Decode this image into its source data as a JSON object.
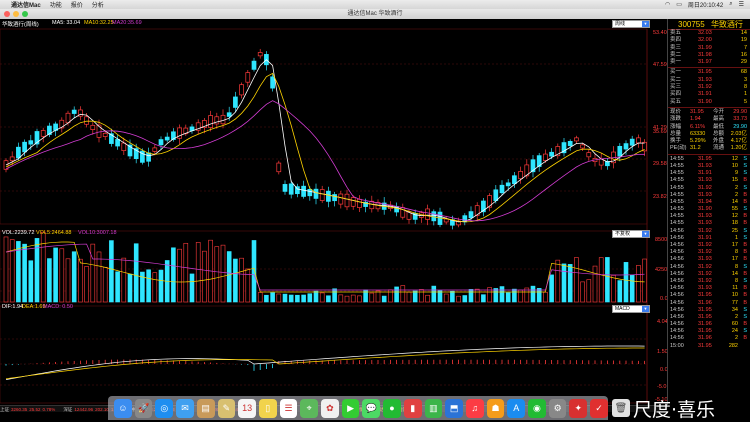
{
  "menubar": {
    "apple": "",
    "app": "通达信Mac",
    "items": [
      "功能",
      "报价",
      "分析"
    ],
    "clock": "周日20:10:42"
  },
  "window": {
    "title": "通达信Mac 华致酒行"
  },
  "chart": {
    "title": "华致酒行(周线)",
    "ma_legend": [
      {
        "t": "MA5: 33.04",
        "c": "#ffffff"
      },
      {
        "t": "MA10:32.25",
        "c": "#ffd400"
      },
      {
        "t": "MA20:35.69",
        "c": "#d23cd2"
      }
    ],
    "vol_legend": [
      {
        "t": "VOL:2239.72",
        "c": "#ffffff"
      },
      {
        "t": "VOL5:2464.88",
        "c": "#ffd400"
      },
      {
        "t": "VOL10:3007.18",
        "c": "#d23cd2"
      }
    ],
    "macd_legend": [
      {
        "t": "DIF:1.94",
        "c": "#ffffff"
      },
      {
        "t": "DEA:1.69",
        "c": "#ffd400"
      },
      {
        "t": "MACD: 0.50",
        "c": "#d23cd2"
      }
    ],
    "period_select": "周线",
    "vol_select": "不复权",
    "macd_select": "MACD",
    "price_axis": [
      "53.40",
      "47.59",
      "41.29",
      "35.69",
      "29.58",
      "23.82"
    ],
    "vol_axis": [
      "8500",
      "4250",
      "0.0"
    ],
    "macd_axis": [
      "4.04",
      "1.50",
      "0.0",
      "-5.0",
      "-5.10"
    ],
    "colors": {
      "up": "#ff3b3b",
      "down": "#2fe6ff",
      "grid": "#5a1010"
    }
  },
  "right_panel": {
    "code": "300755",
    "name": "华致酒行",
    "order_book": [
      {
        "l": "卖五",
        "p": "32.03",
        "v": "14"
      },
      {
        "l": "卖四",
        "p": "32.00",
        "v": "19"
      },
      {
        "l": "卖三",
        "p": "31.99",
        "v": "7"
      },
      {
        "l": "卖二",
        "p": "31.98",
        "v": "16"
      },
      {
        "l": "卖一",
        "p": "31.97",
        "v": "29"
      },
      {
        "l": "买一",
        "p": "31.95",
        "v": "68"
      },
      {
        "l": "买二",
        "p": "31.93",
        "v": "3"
      },
      {
        "l": "买三",
        "p": "31.92",
        "v": "8"
      },
      {
        "l": "买四",
        "p": "31.91",
        "v": "1"
      },
      {
        "l": "买五",
        "p": "31.90",
        "v": "5"
      }
    ],
    "stats": [
      {
        "a": "现价",
        "b": "31.95",
        "c": "今开",
        "d": "29.90"
      },
      {
        "a": "涨跌",
        "b": "1.94",
        "c": "最高",
        "d": "33.73"
      },
      {
        "a": "涨幅",
        "b": "6.11%",
        "c": "最低",
        "d": "29.90"
      },
      {
        "a": "总量",
        "b": "63330",
        "c": "总额",
        "d": "2.03亿"
      },
      {
        "a": "换手",
        "b": "5.29%",
        "c": "外盘",
        "d": "4.17亿"
      },
      {
        "a": "PE(动)",
        "b": "31.2",
        "c": "流通",
        "d": "1.20亿"
      }
    ],
    "ticks": [
      {
        "t": "14:55",
        "p": "31.95",
        "v": "12",
        "s": "S"
      },
      {
        "t": "14:55",
        "p": "31.93",
        "v": "10",
        "s": "S"
      },
      {
        "t": "14:55",
        "p": "31.91",
        "v": "9",
        "s": "S"
      },
      {
        "t": "14:55",
        "p": "31.93",
        "v": "15",
        "s": "B"
      },
      {
        "t": "14:55",
        "p": "31.92",
        "v": "2",
        "s": "S"
      },
      {
        "t": "14:55",
        "p": "31.93",
        "v": "2",
        "s": "B"
      },
      {
        "t": "14:55",
        "p": "31.94",
        "v": "14",
        "s": "B"
      },
      {
        "t": "14:55",
        "p": "31.90",
        "v": "55",
        "s": "S"
      },
      {
        "t": "14:55",
        "p": "31.93",
        "v": "12",
        "s": "B"
      },
      {
        "t": "14:55",
        "p": "31.93",
        "v": "18",
        "s": "B"
      },
      {
        "t": "14:56",
        "p": "31.92",
        "v": "25",
        "s": "S"
      },
      {
        "t": "14:56",
        "p": "31.91",
        "v": "1",
        "s": "S"
      },
      {
        "t": "14:56",
        "p": "31.92",
        "v": "17",
        "s": "B"
      },
      {
        "t": "14:56",
        "p": "31.92",
        "v": "8",
        "s": "B"
      },
      {
        "t": "14:56",
        "p": "31.93",
        "v": "17",
        "s": "B"
      },
      {
        "t": "14:56",
        "p": "31.92",
        "v": "8",
        "s": "S"
      },
      {
        "t": "14:56",
        "p": "31.92",
        "v": "14",
        "s": "B"
      },
      {
        "t": "14:56",
        "p": "31.92",
        "v": "8",
        "s": "S"
      },
      {
        "t": "14:56",
        "p": "31.93",
        "v": "11",
        "s": "B"
      },
      {
        "t": "14:56",
        "p": "31.95",
        "v": "10",
        "s": "B"
      },
      {
        "t": "14:56",
        "p": "31.96",
        "v": "77",
        "s": "B"
      },
      {
        "t": "14:56",
        "p": "31.95",
        "v": "34",
        "s": "S"
      },
      {
        "t": "14:56",
        "p": "31.95",
        "v": "2",
        "s": "S"
      },
      {
        "t": "14:56",
        "p": "31.96",
        "v": "60",
        "s": "B"
      },
      {
        "t": "14:56",
        "p": "31.95",
        "v": "24",
        "s": "S"
      },
      {
        "t": "14:56",
        "p": "31.96",
        "v": "2",
        "s": "B"
      },
      {
        "t": "15:00",
        "p": "31.95",
        "v": "282",
        "s": ""
      }
    ]
  },
  "status_bar": [
    {
      "t": "上证",
      "c": "#ccc"
    },
    {
      "t": "3260.35",
      "c": "#ff3b3b"
    },
    {
      "t": "25.52",
      "c": "#ff3b3b"
    },
    {
      "t": "0.78%",
      "c": "#ff3b3b"
    },
    {
      "t": "深证",
      "c": "#ccc"
    },
    {
      "t": "12442.96",
      "c": "#ff3b3b"
    },
    {
      "t": "202.10",
      "c": "#ff3b3b"
    },
    {
      "t": "1.57%",
      "c": "#ff3b3b"
    },
    {
      "t": "中小",
      "c": "#ccc"
    },
    {
      "t": "8813.21",
      "c": "#ff3b3b"
    },
    {
      "t": "158.43",
      "c": "#ff3b3b"
    },
    {
      "t": "1.83%",
      "c": "#ff3b3b"
    },
    {
      "t": "创业",
      "c": "#ccc"
    },
    {
      "t": "2526.02",
      "c": "#ff3b3b"
    },
    {
      "t": "53.84",
      "c": "#ff3b3b"
    },
    {
      "t": "2.18%",
      "c": "#ff3b3b"
    },
    {
      "t": "行情主站_通达信深圳电信行情1",
      "c": "#ffd400"
    }
  ],
  "dock": [
    {
      "n": "finder-icon",
      "g": "☺",
      "c": "#3b8df0"
    },
    {
      "n": "launchpad-icon",
      "g": "🚀",
      "c": "#888"
    },
    {
      "n": "safari-icon",
      "g": "◎",
      "c": "#1e8ef0"
    },
    {
      "n": "mail-icon",
      "g": "✉",
      "c": "#3fa0f0"
    },
    {
      "n": "contacts-icon",
      "g": "▤",
      "c": "#c89a5a"
    },
    {
      "n": "notes-icon",
      "g": "✎",
      "c": "#d8c070"
    },
    {
      "n": "calendar-icon",
      "g": "13",
      "c": "#f5f5f5"
    },
    {
      "n": "stickies-icon",
      "g": "▯",
      "c": "#f1d34c"
    },
    {
      "n": "reminders-icon",
      "g": "☰",
      "c": "#ffffff"
    },
    {
      "n": "maps-icon",
      "g": "⌖",
      "c": "#5cb85c"
    },
    {
      "n": "photos-icon",
      "g": "✿",
      "c": "#f0f0f0"
    },
    {
      "n": "facetime-icon",
      "g": "▶",
      "c": "#3c3"
    },
    {
      "n": "messages-icon",
      "g": "💬",
      "c": "#4cd964"
    },
    {
      "n": "wechat-icon",
      "g": "●",
      "c": "#22bb33"
    },
    {
      "n": "books-icon",
      "g": "▮",
      "c": "#e04040"
    },
    {
      "n": "numbers-icon",
      "g": "▥",
      "c": "#3bb54a"
    },
    {
      "n": "keynote-icon",
      "g": "⬒",
      "c": "#2b73d6"
    },
    {
      "n": "music-icon",
      "g": "♫",
      "c": "#fc3c44"
    },
    {
      "n": "ibooks-icon",
      "g": "☗",
      "c": "#f59c1a"
    },
    {
      "n": "appstore-icon",
      "g": "A",
      "c": "#1a8cf0"
    },
    {
      "n": "wechat2-icon",
      "g": "◉",
      "c": "#22bb33"
    },
    {
      "n": "preferences-icon",
      "g": "⚙",
      "c": "#888"
    },
    {
      "n": "tongdaxin-icon",
      "g": "✦",
      "c": "#d83030"
    },
    {
      "n": "klink-icon",
      "g": "✓",
      "c": "#e03030"
    }
  ],
  "watermark": {
    "text": "尺度·喜乐"
  }
}
